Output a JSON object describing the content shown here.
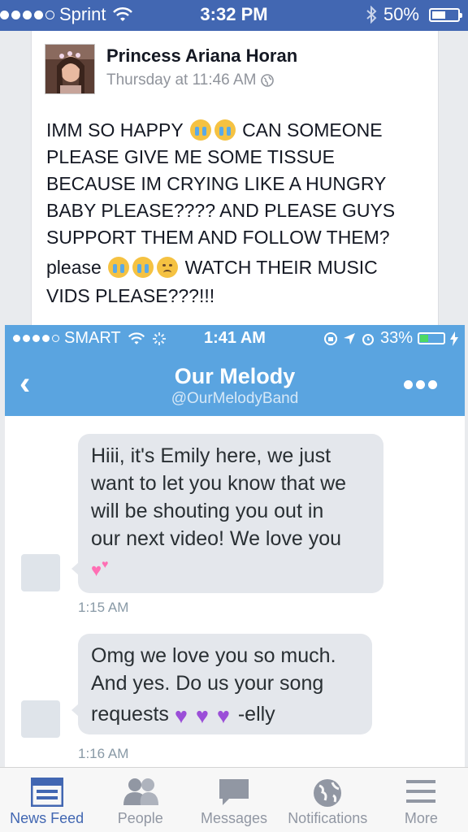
{
  "status_bar": {
    "carrier": "Sprint",
    "time": "3:32 PM",
    "battery": "50%",
    "battery_level": 0.5
  },
  "post": {
    "author": "Princess Ariana Horan",
    "timestamp": "Thursday at 11:46 AM",
    "lines": [
      "IMM SO HAPPY",
      "CAN SOMEONE",
      "PLEASE GIVE ME SOME TISSUE",
      "BECAUSE IM CRYING LIKE A HUNGRY",
      "BABY PLEASE???? AND PLEASE GUYS",
      "SUPPORT THEM AND FOLLOW THEM?",
      "please",
      "WATCH THEIR MUSIC",
      "VIDS PLEASE???!!!"
    ]
  },
  "screenshot": {
    "status": {
      "carrier": "SMART",
      "time": "1:41 AM",
      "battery": "33%",
      "battery_level": 0.33
    },
    "header": {
      "title": "Our Melody",
      "handle": "@OurMelodyBand"
    },
    "messages": [
      {
        "lines": [
          "Hiii, it's Emily here, we just",
          "want to let you know that we",
          "will be shouting you out in",
          "our next video! We love you"
        ],
        "time": "1:15 AM"
      },
      {
        "lines": [
          "Omg we love you so much.",
          "And yes. Do us your song",
          "requests"
        ],
        "signoff": "-elly",
        "time": "1:16 AM"
      }
    ]
  },
  "tabs": [
    {
      "label": "News Feed",
      "icon": "news-feed-icon",
      "active": true
    },
    {
      "label": "People",
      "icon": "people-icon",
      "active": false
    },
    {
      "label": "Messages",
      "icon": "messages-icon",
      "active": false
    },
    {
      "label": "Notifications",
      "icon": "globe-icon",
      "active": false
    },
    {
      "label": "More",
      "icon": "menu-icon",
      "active": false
    }
  ],
  "colors": {
    "facebook_blue": "#4267b2",
    "twitter_blue": "#5aa4e0",
    "bubble_gray": "#e4e7ec"
  }
}
